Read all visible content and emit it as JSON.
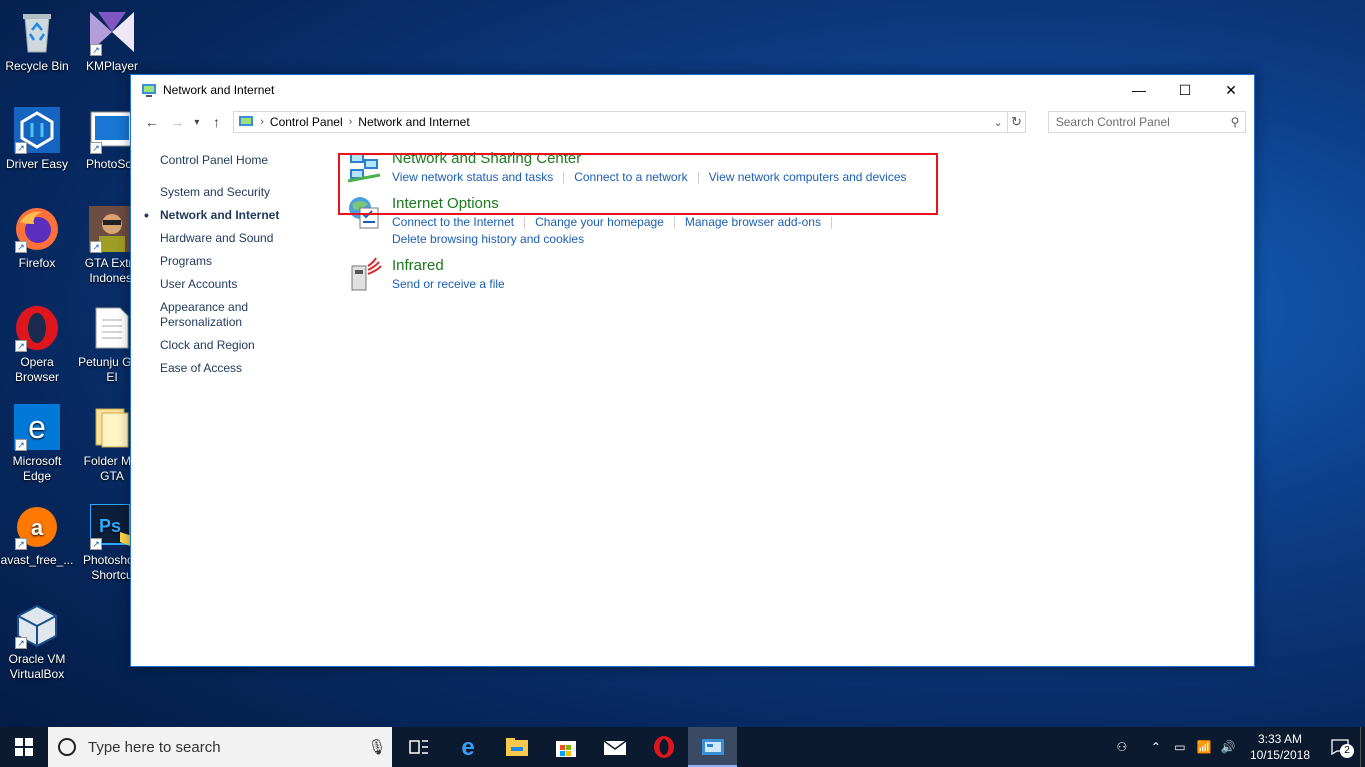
{
  "desktop": {
    "icons": [
      {
        "label": "Recycle Bin"
      },
      {
        "label": "KMPlayer"
      },
      {
        "label": "Driver Easy"
      },
      {
        "label": "PhotoSca"
      },
      {
        "label": "Firefox"
      },
      {
        "label": "GTA Extre Indonesi"
      },
      {
        "label": "Opera Browser"
      },
      {
        "label": "Petunju GTA EI"
      },
      {
        "label": "Microsoft Edge"
      },
      {
        "label": "Folder MO GTA"
      },
      {
        "label": "avast_free_..."
      },
      {
        "label": "Photosho - Shortcu"
      },
      {
        "label": "Oracle VM VirtualBox"
      }
    ]
  },
  "window": {
    "title": "Network and Internet",
    "breadcrumb": [
      "Control Panel",
      "Network and Internet"
    ],
    "search_placeholder": "Search Control Panel"
  },
  "sidebar": {
    "home": "Control Panel Home",
    "items": [
      {
        "label": "System and Security"
      },
      {
        "label": "Network and Internet"
      },
      {
        "label": "Hardware and Sound"
      },
      {
        "label": "Programs"
      },
      {
        "label": "User Accounts"
      },
      {
        "label": "Appearance and Personalization"
      },
      {
        "label": "Clock and Region"
      },
      {
        "label": "Ease of Access"
      }
    ]
  },
  "categories": [
    {
      "title": "Network and Sharing Center",
      "links": [
        "View network status and tasks",
        "Connect to a network",
        "View network computers and devices"
      ]
    },
    {
      "title": "Internet Options",
      "links": [
        "Connect to the Internet",
        "Change your homepage",
        "Manage browser add-ons",
        "Delete browsing history and cookies"
      ]
    },
    {
      "title": "Infrared",
      "links": [
        "Send or receive a file"
      ]
    }
  ],
  "taskbar": {
    "search_placeholder": "Type here to search",
    "time": "3:33 AM",
    "date": "10/15/2018",
    "notification_count": "2"
  },
  "colors": {
    "highlight": "#e8141a",
    "link": "#1a5fb4",
    "category_title": "#1a7a1a"
  }
}
